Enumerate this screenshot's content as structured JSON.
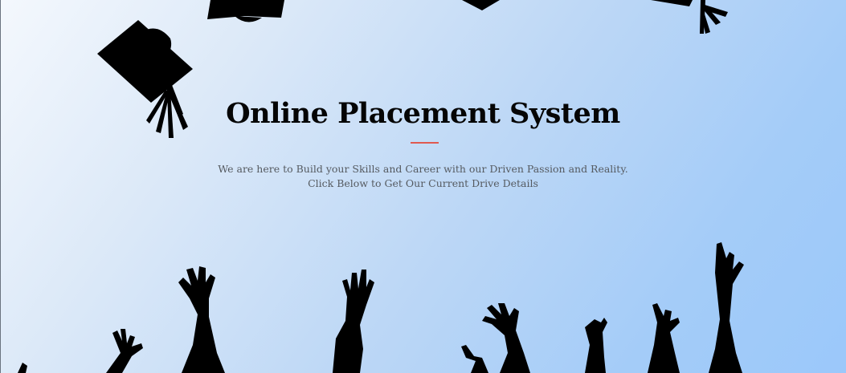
{
  "hero": {
    "title": "Online Placement System",
    "subtitle_line1": "We are here to Build your Skills and Career with our Driven Passion and Reality.",
    "subtitle_line2": "Click Below to Get Our Current Drive Details",
    "accent_color": "#e0594f"
  },
  "background": {
    "image": "graduation-celebration-illustration",
    "icons": [
      "graduation-cap-icon",
      "raised-hands-icon"
    ]
  }
}
